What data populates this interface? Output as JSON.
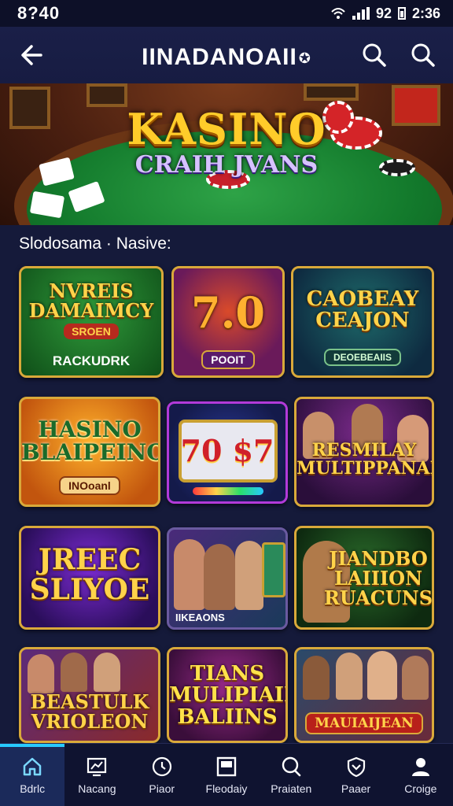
{
  "status": {
    "time": "8?40",
    "signal_label": "92",
    "clock_right": "2:36"
  },
  "app_bar": {
    "title": "IINADANOAII",
    "logo_mark": "✪"
  },
  "hero": {
    "title": "KASINO",
    "subtitle": "CRAIH JVANS"
  },
  "section": {
    "title": "Slodosama · Nasive:"
  },
  "tiles": [
    {
      "title": "NVREIS DAMAIMCY",
      "badge": "SROEN",
      "label": "RACKUDRK"
    },
    {
      "title": "7.0",
      "label": "POOIT"
    },
    {
      "title": "CAOBEAY CEAJON",
      "label": "DEOEBEAIIS"
    },
    {
      "title": "HASINO BLAIPEINON",
      "label": "INOoanl"
    },
    {
      "title": "70 $7",
      "label": ""
    },
    {
      "title": "RESMILAY MULTIPPANAR",
      "label": ""
    },
    {
      "title": "JREEC SLIYOE",
      "label": ""
    },
    {
      "title": "",
      "label": "IIKEAONS"
    },
    {
      "title": "JIANDBO LAIIION RUACUNS",
      "label": ""
    },
    {
      "title": "BEASTULK VRIOLEON",
      "label": ""
    },
    {
      "title": "TIANS MULIPIAII BALIINS",
      "label": ""
    },
    {
      "title": "MAUIAIJEAN",
      "label": ""
    }
  ],
  "nav": [
    {
      "label": "Bdrlc",
      "icon": "home-icon",
      "active": true
    },
    {
      "label": "Nacang",
      "icon": "tv-icon"
    },
    {
      "label": "Piaor",
      "icon": "clock-icon"
    },
    {
      "label": "Fleodaiy",
      "icon": "screen-icon"
    },
    {
      "label": "Praiaten",
      "icon": "chat-icon"
    },
    {
      "label": "Paaer",
      "icon": "shield-icon"
    },
    {
      "label": "Croige",
      "icon": "profile-icon"
    }
  ],
  "colors": {
    "accent": "#27c9ff",
    "gold": "#d9a93a",
    "background": "#151a3a"
  }
}
